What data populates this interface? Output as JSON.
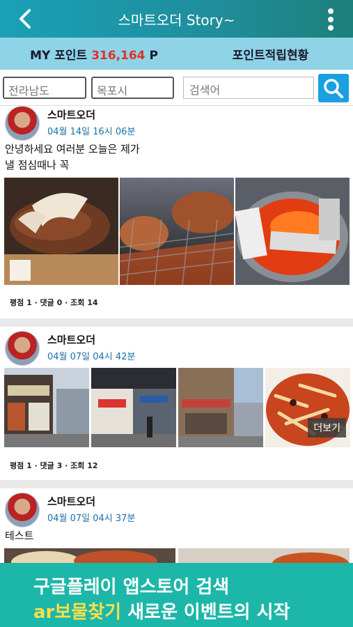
{
  "header": {
    "title": "스마트오더 Story~",
    "back_icon": "back-arrow-icon",
    "menu_icon": "more-vertical-icon"
  },
  "points": {
    "label": "MY 포인트",
    "value": "316,164",
    "unit": "P",
    "status_link": "포인트적립현황"
  },
  "filter": {
    "region": "전라남도",
    "city": "목포시",
    "search_placeholder": "검색어",
    "search_icon": "search-icon"
  },
  "posts": [
    {
      "author": "스마트오더",
      "date": "04월 14일 16시 06분",
      "text_line1": "안녕하세요 여러분 오늘은 제가",
      "text_line2": "낼 점심때나 꼭",
      "stats": "평점 1 · 댓글 0 · 조회 14"
    },
    {
      "author": "스마트오더",
      "date": "04월 07일 04시 42분",
      "more_label": "더보기",
      "stats": "평점 1 · 댓글 3 · 조회 12"
    },
    {
      "author": "스마트오더",
      "date": "04월 07일 04시 37분",
      "text_line1": "테스트"
    }
  ],
  "banner": {
    "line1": "구글플레이 앱스토어 검색",
    "line2_highlight": "ar보물찾기",
    "line2_rest": " 새로운 이벤트의 시작"
  },
  "colors": {
    "accent": "#1aa0b6",
    "point_value": "#e0312b",
    "date_text": "#1a6fa8",
    "banner_bg": "#1cb7a8",
    "banner_highlight": "#f7e04a"
  }
}
